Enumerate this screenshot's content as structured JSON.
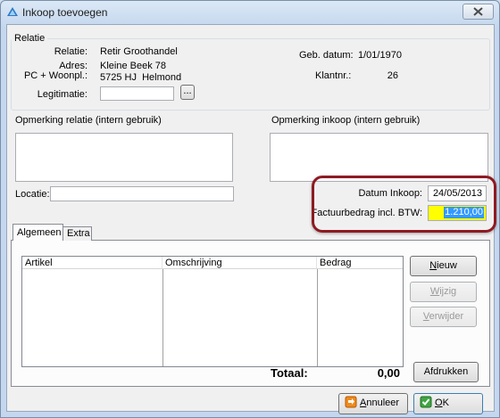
{
  "window": {
    "title": "Inkoop toevoegen",
    "close_symbol": "X"
  },
  "relatie": {
    "group_label": "Relatie",
    "relatie_label": "Relatie:",
    "relatie_value": "Retir Groothandel",
    "adres_label": "Adres:",
    "adres_value": "Kleine Beek 78",
    "pc_label": "PC + Woonpl.:",
    "pc_value": "5725 HJ  Helmond",
    "legitimatie_label": "Legitimatie:",
    "legitimatie_value": "",
    "browse_label": "...",
    "geb_label": "Geb. datum:",
    "geb_value": "1/01/1970",
    "klantnr_label": "Klantnr.:",
    "klantnr_value": "26"
  },
  "opmerking_relatie_label": "Opmerking relatie (intern gebruik)",
  "opmerking_inkoop_label": "Opmerking inkoop (intern gebruik)",
  "locatie_label": "Locatie:",
  "locatie_value": "",
  "datum_label": "Datum Inkoop:",
  "datum_value": "24/05/2013",
  "factuur_label": "Factuurbedrag incl. BTW:",
  "factuur_value": "1.210,00",
  "tabs": [
    {
      "label": "Algemeen",
      "active": true
    },
    {
      "label": "Extra",
      "active": false
    }
  ],
  "grid": {
    "columns": [
      "Artikel",
      "Omschrijving",
      "Bedrag"
    ]
  },
  "buttons": {
    "nieuw_pre": "",
    "nieuw_ul": "N",
    "nieuw_post": "ieuw",
    "wijzig_pre": "",
    "wijzig_ul": "W",
    "wijzig_post": "ijzig",
    "verwijder_pre": "",
    "verwijder_ul": "V",
    "verwijder_post": "erwijder",
    "afdrukken": "Afdrukken",
    "annuleer_pre": "",
    "annuleer_ul": "A",
    "annuleer_post": "nnuleer",
    "ok_pre": "",
    "ok_ul": "O",
    "ok_post": "K"
  },
  "totaal_label": "Totaal:",
  "totaal_value": "0,00",
  "colors": {
    "highlight_border": "#8e1a22",
    "factuur_bg": "#ffff00",
    "selection": "#3399ff"
  }
}
